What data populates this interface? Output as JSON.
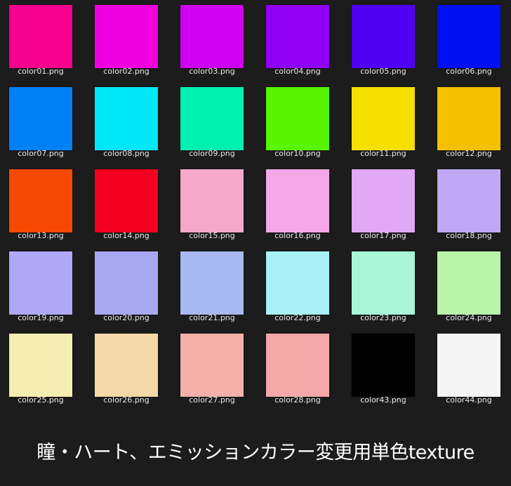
{
  "files": [
    {
      "name": "color01.png",
      "color": "#f5008f"
    },
    {
      "name": "color02.png",
      "color": "#f000e0"
    },
    {
      "name": "color03.png",
      "color": "#d000f0"
    },
    {
      "name": "color04.png",
      "color": "#9000f5"
    },
    {
      "name": "color05.png",
      "color": "#5000f0"
    },
    {
      "name": "color06.png",
      "color": "#0010f0"
    },
    {
      "name": "color07.png",
      "color": "#0080f5"
    },
    {
      "name": "color08.png",
      "color": "#00e8f5"
    },
    {
      "name": "color09.png",
      "color": "#00f0b0"
    },
    {
      "name": "color10.png",
      "color": "#58f500"
    },
    {
      "name": "color11.png",
      "color": "#f5e000"
    },
    {
      "name": "color12.png",
      "color": "#f5c000"
    },
    {
      "name": "color13.png",
      "color": "#f54800"
    },
    {
      "name": "color14.png",
      "color": "#f50020"
    },
    {
      "name": "color15.png",
      "color": "#f5a8c8"
    },
    {
      "name": "color16.png",
      "color": "#f5a8e8"
    },
    {
      "name": "color17.png",
      "color": "#e0a8f5"
    },
    {
      "name": "color18.png",
      "color": "#c0a8f5"
    },
    {
      "name": "color19.png",
      "color": "#b0a8f5"
    },
    {
      "name": "color20.png",
      "color": "#a8a8f0"
    },
    {
      "name": "color21.png",
      "color": "#a8b8f0"
    },
    {
      "name": "color22.png",
      "color": "#a8f0f5"
    },
    {
      "name": "color23.png",
      "color": "#a8f5d8"
    },
    {
      "name": "color24.png",
      "color": "#b8f5a8"
    },
    {
      "name": "color25.png",
      "color": "#f5eeb0"
    },
    {
      "name": "color26.png",
      "color": "#f5d8a8"
    },
    {
      "name": "color27.png",
      "color": "#f5b0a8"
    },
    {
      "name": "color28.png",
      "color": "#f5a8a8"
    },
    {
      "name": "color43.png",
      "color": "#000000"
    },
    {
      "name": "color44.png",
      "color": "#f5f5f5"
    }
  ],
  "caption": "瞳・ハート、エミッションカラー変更用単色texture"
}
